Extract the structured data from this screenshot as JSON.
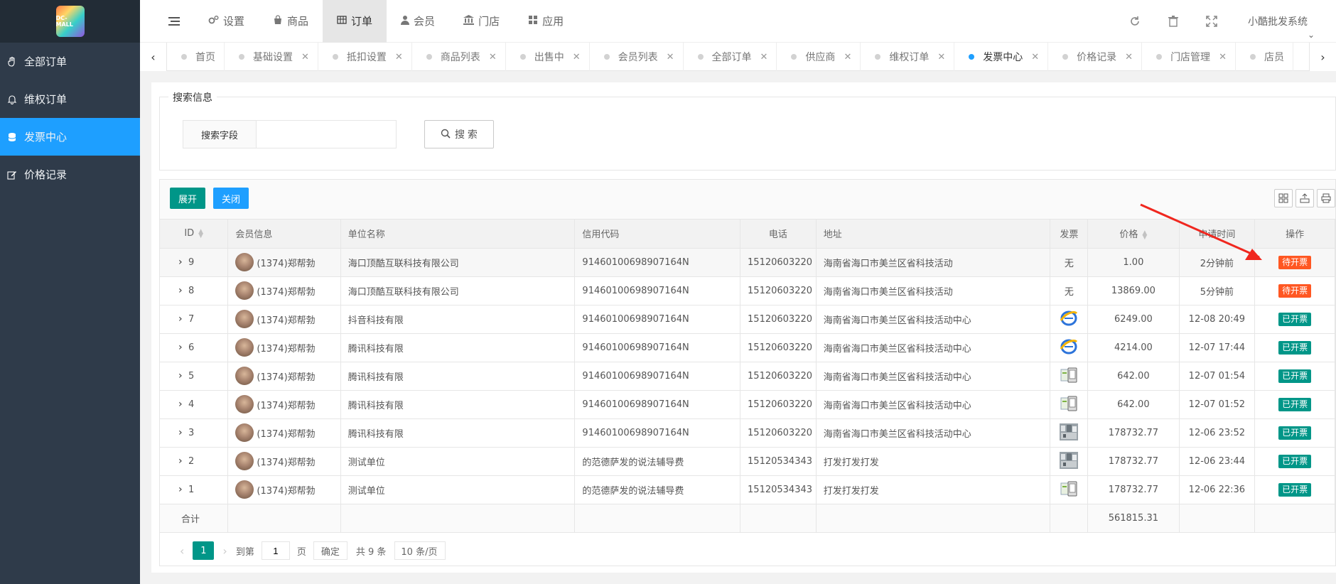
{
  "brand": {
    "logo_text": "DC-MALL",
    "system_name": "小酷批发系统"
  },
  "sidebar": {
    "items": [
      {
        "label": "全部订单",
        "icon": "hand-icon"
      },
      {
        "label": "维权订单",
        "icon": "bell-icon"
      },
      {
        "label": "发票中心",
        "icon": "database-icon",
        "active": true
      },
      {
        "label": "价格记录",
        "icon": "edit-icon"
      }
    ]
  },
  "topnav": {
    "items": [
      {
        "label": "设置",
        "icon": "gears-icon"
      },
      {
        "label": "商品",
        "icon": "bag-icon"
      },
      {
        "label": "订单",
        "icon": "table-icon",
        "active": true
      },
      {
        "label": "会员",
        "icon": "user-icon"
      },
      {
        "label": "门店",
        "icon": "bank-icon"
      },
      {
        "label": "应用",
        "icon": "grid-icon"
      }
    ]
  },
  "tabs": [
    {
      "label": "首页",
      "closable": false
    },
    {
      "label": "基础设置",
      "closable": true
    },
    {
      "label": "抵扣设置",
      "closable": true
    },
    {
      "label": "商品列表",
      "closable": true
    },
    {
      "label": "出售中",
      "closable": true
    },
    {
      "label": "会员列表",
      "closable": true
    },
    {
      "label": "全部订单",
      "closable": true
    },
    {
      "label": "供应商",
      "closable": true
    },
    {
      "label": "维权订单",
      "closable": true
    },
    {
      "label": "发票中心",
      "closable": true,
      "active": true
    },
    {
      "label": "价格记录",
      "closable": true
    },
    {
      "label": "门店管理",
      "closable": true
    },
    {
      "label": "店员",
      "closable": false
    }
  ],
  "search": {
    "legend": "搜索信息",
    "field_label": "搜索字段",
    "value": "",
    "button_label": "搜 索"
  },
  "toolbar": {
    "expand_label": "展开",
    "close_label": "关闭"
  },
  "table": {
    "headers": {
      "id": "ID",
      "member": "会员信息",
      "company": "单位名称",
      "credit": "信用代码",
      "phone": "电话",
      "address": "地址",
      "invoice": "发票",
      "price": "价格",
      "time": "申请时间",
      "action": "操作"
    },
    "rows": [
      {
        "id": "9",
        "member": "(1374)郑帮勃",
        "company": "海口顶酷互联科技有限公司",
        "credit": "9146010069890716​4N",
        "phone": "15120603220",
        "address": "海南省海口市美兰区省科技活动",
        "invoice": "无",
        "invoice_type": "none",
        "price": "1.00",
        "time": "2分钟前",
        "status": "待开票",
        "status_type": "pending"
      },
      {
        "id": "8",
        "member": "(1374)郑帮勃",
        "company": "海口顶酷互联科技有限公司",
        "credit": "91460100698907164N",
        "phone": "15120603220",
        "address": "海南省海口市美兰区省科技活动",
        "invoice": "无",
        "invoice_type": "none",
        "price": "13869.00",
        "time": "5分钟前",
        "status": "待开票",
        "status_type": "pending"
      },
      {
        "id": "7",
        "member": "(1374)郑帮勃",
        "company": "抖音科技有限",
        "credit": "91460100698907164N",
        "phone": "15120603220",
        "address": "海南省海口市美兰区省科技活动中心",
        "invoice": "",
        "invoice_type": "ie",
        "price": "6249.00",
        "time": "12-08 20:49",
        "status": "已开票",
        "status_type": "done"
      },
      {
        "id": "6",
        "member": "(1374)郑帮勃",
        "company": "腾讯科技有限",
        "credit": "91460100698907164N",
        "phone": "15120603220",
        "address": "海南省海口市美兰区省科技活动中心",
        "invoice": "",
        "invoice_type": "ie",
        "price": "4214.00",
        "time": "12-07 17:44",
        "status": "已开票",
        "status_type": "done"
      },
      {
        "id": "5",
        "member": "(1374)郑帮勃",
        "company": "腾讯科技有限",
        "credit": "91460100698907164N",
        "phone": "15120603220",
        "address": "海南省海口市美兰区省科技活动中心",
        "invoice": "",
        "invoice_type": "doc",
        "price": "642.00",
        "time": "12-07 01:54",
        "status": "已开票",
        "status_type": "done"
      },
      {
        "id": "4",
        "member": "(1374)郑帮勃",
        "company": "腾讯科技有限",
        "credit": "91460100698907164N",
        "phone": "15120603220",
        "address": "海南省海口市美兰区省科技活动中心",
        "invoice": "",
        "invoice_type": "doc",
        "price": "642.00",
        "time": "12-07 01:52",
        "status": "已开票",
        "status_type": "done"
      },
      {
        "id": "3",
        "member": "(1374)郑帮勃",
        "company": "腾讯科技有限",
        "credit": "91460100698907164N",
        "phone": "15120603220",
        "address": "海南省海口市美兰区省科技活动中心",
        "invoice": "",
        "invoice_type": "photo",
        "price": "178732.77",
        "time": "12-06 23:52",
        "status": "已开票",
        "status_type": "done"
      },
      {
        "id": "2",
        "member": "(1374)郑帮勃",
        "company": "测试单位",
        "credit": "的范德萨发的说法辅导费",
        "phone": "15120534343",
        "address": "打发打发打发",
        "invoice": "",
        "invoice_type": "photo",
        "price": "178732.77",
        "time": "12-06 23:44",
        "status": "已开票",
        "status_type": "done"
      },
      {
        "id": "1",
        "member": "(1374)郑帮勃",
        "company": "测试单位",
        "credit": "的范德萨发的说法辅导费",
        "phone": "15120534343",
        "address": "打发打发打发",
        "invoice": "",
        "invoice_type": "doc",
        "price": "178732.77",
        "time": "12-06 22:36",
        "status": "已开票",
        "status_type": "done"
      }
    ],
    "sum_label": "合计",
    "sum_price": "561815.31"
  },
  "pager": {
    "current": "1",
    "goto_prefix": "到第",
    "goto_value": "1",
    "goto_suffix": "页",
    "confirm": "确定",
    "total": "共 9 条",
    "page_size": "10 条/页"
  },
  "colors": {
    "primary": "#009688",
    "accent": "#1e9fff",
    "pending": "#ff5722",
    "sidebar": "#2f3b4a"
  }
}
